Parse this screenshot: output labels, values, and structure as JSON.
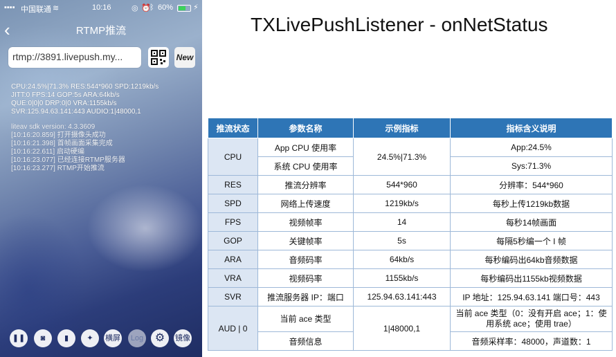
{
  "phone": {
    "status": {
      "carrier": "中国联通",
      "time": "10:16",
      "battery": "60%"
    },
    "nav": {
      "back_icon": "chevron-left-icon",
      "title": "RTMP推流"
    },
    "url_value": "rtmp://3891.livepush.my...",
    "new_label": "New",
    "stats": [
      "CPU:24.5%|71.3%     RES:544*960    SPD:1219kb/s",
      "JITT:0      FPS:14      GOP:5s      ARA:64kb/s",
      "QUE:0|0|0 DRP:0|0     VRA:1155kb/s",
      "SVR:125.94.63.141:443    AUDIO:1|48000,1"
    ],
    "logs": [
      "liteav sdk version: 4.3.3609",
      "[10:16:20.859] 打开摄像头成功",
      "[10:16:21.398] 首帧画面采集完成",
      "[10:16:22.611] 启动硬编",
      "[10:16:23.077] 已经连接RTMP服务器",
      "[10:16:23.277] RTMP开始推流"
    ],
    "toolbar": {
      "landscape": "横屏",
      "log": "Log",
      "mirror": "镜像"
    }
  },
  "heading": "TXLivePushListener - onNetStatus",
  "table": {
    "headers": [
      "推流状态",
      "参数名称",
      "示例指标",
      "指标含义说明"
    ],
    "rows": {
      "cpu": {
        "key": "CPU",
        "name1": "App CPU 使用率",
        "name2": "系统 CPU 使用率",
        "example": "24.5%|71.3%",
        "desc1": "App:24.5%",
        "desc2": "Sys:71.3%"
      },
      "res": {
        "key": "RES",
        "name": "推流分辨率",
        "example": "544*960",
        "desc": "分辨率：544*960"
      },
      "spd": {
        "key": "SPD",
        "name": "网络上传速度",
        "example": "1219kb/s",
        "desc": "每秒上传1219kb数据"
      },
      "fps": {
        "key": "FPS",
        "name": "视频帧率",
        "example": "14",
        "desc": "每秒14帧画面"
      },
      "gop": {
        "key": "GOP",
        "name": "关键帧率",
        "example": "5s",
        "desc": "每隔5秒编一个 I 帧"
      },
      "ara": {
        "key": "ARA",
        "name": "音频码率",
        "example": "64kb/s",
        "desc": "每秒编码出64kb音频数据"
      },
      "vra": {
        "key": "VRA",
        "name": "视频码率",
        "example": "1155kb/s",
        "desc": "每秒编码出1155kb视频数据"
      },
      "svr": {
        "key": "SVR",
        "name": "推流服务器 IP：端口",
        "example": "125.94.63.141:443",
        "desc": "IP 地址：125.94.63.141 端口号：443"
      },
      "aud": {
        "key": "AUD | 0",
        "name1": "当前 ace 类型",
        "name2": "音频信息",
        "example": "1|48000,1",
        "desc1": "当前 ace 类型（0：没有开启 ace；1：使用系统 ace；使用 trae）",
        "desc2": "音频采样率：48000，声道数：1"
      }
    }
  },
  "colors": {
    "header_bg": "#2e75b6",
    "key_col_bg": "#dce6f3"
  }
}
